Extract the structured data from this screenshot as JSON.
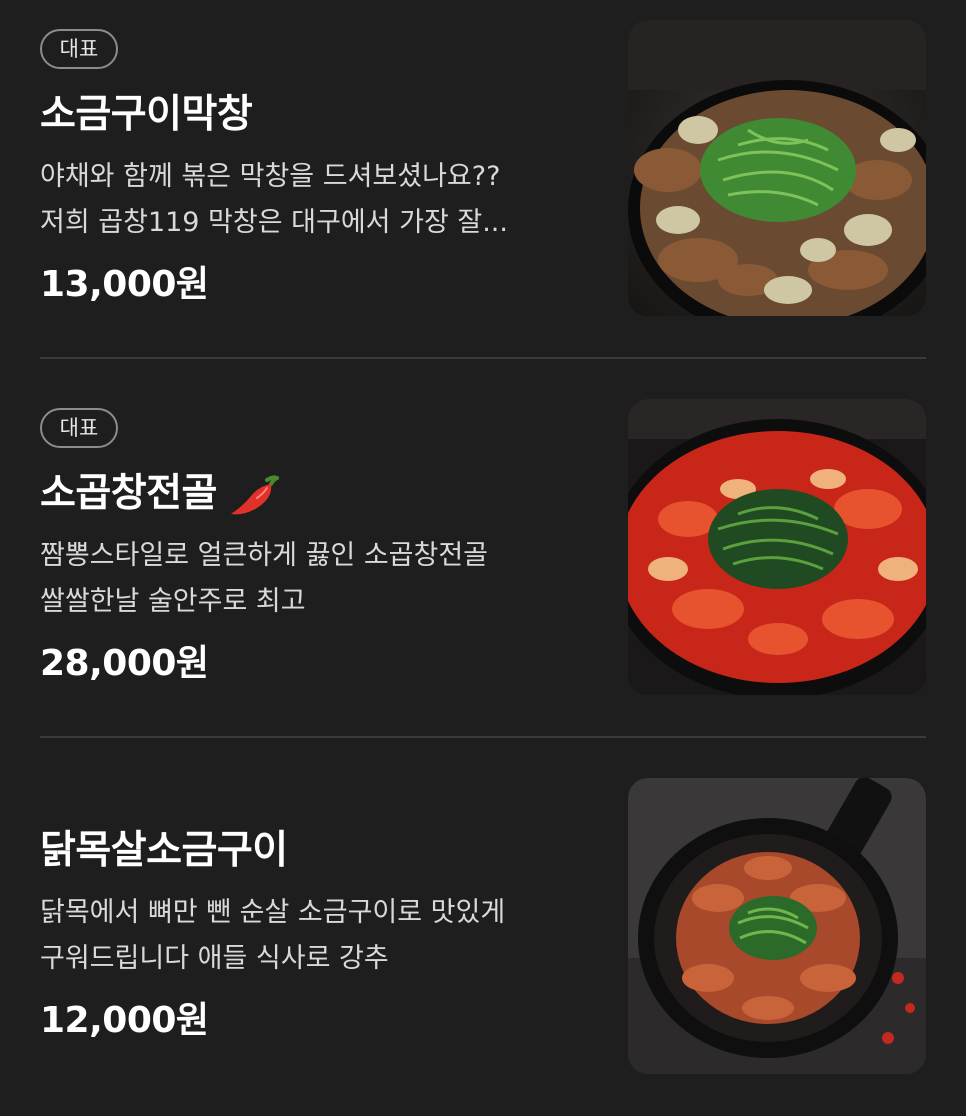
{
  "menu": {
    "items": [
      {
        "badge": "대표",
        "name": "소금구이막창",
        "description_lines": [
          "야채와 함께 볶은 막창을 드셔보셨나요??",
          "저희 곱창119 막창은 대구에서 가장 잘..."
        ],
        "price": "13,000원",
        "image_icon": "stir-fried-makchang-photo"
      },
      {
        "badge": "대표",
        "name": "소곱창전골",
        "spicy_icon": "chili-pepper-icon",
        "description_lines": [
          "짬뽕스타일로 얼큰하게 끓인 소곱창전골",
          "쌀쌀한날 술안주로 최고"
        ],
        "price": "28,000원",
        "image_icon": "gopchang-hotpot-photo"
      },
      {
        "name": "닭목살소금구이",
        "description_lines": [
          "닭목에서 뼈만 뺀 순살 소금구이로 맛있게",
          "구워드립니다 애들 식사로 강추"
        ],
        "price": "12,000원",
        "image_icon": "chicken-neck-skillet-photo"
      }
    ]
  },
  "colors": {
    "background": "#1e1e1f",
    "text": "#ffffff",
    "description": "#d9d9d9",
    "badge_border": "#8c8c8e",
    "divider": "#3b3b3d",
    "chili": "#e0312a"
  }
}
